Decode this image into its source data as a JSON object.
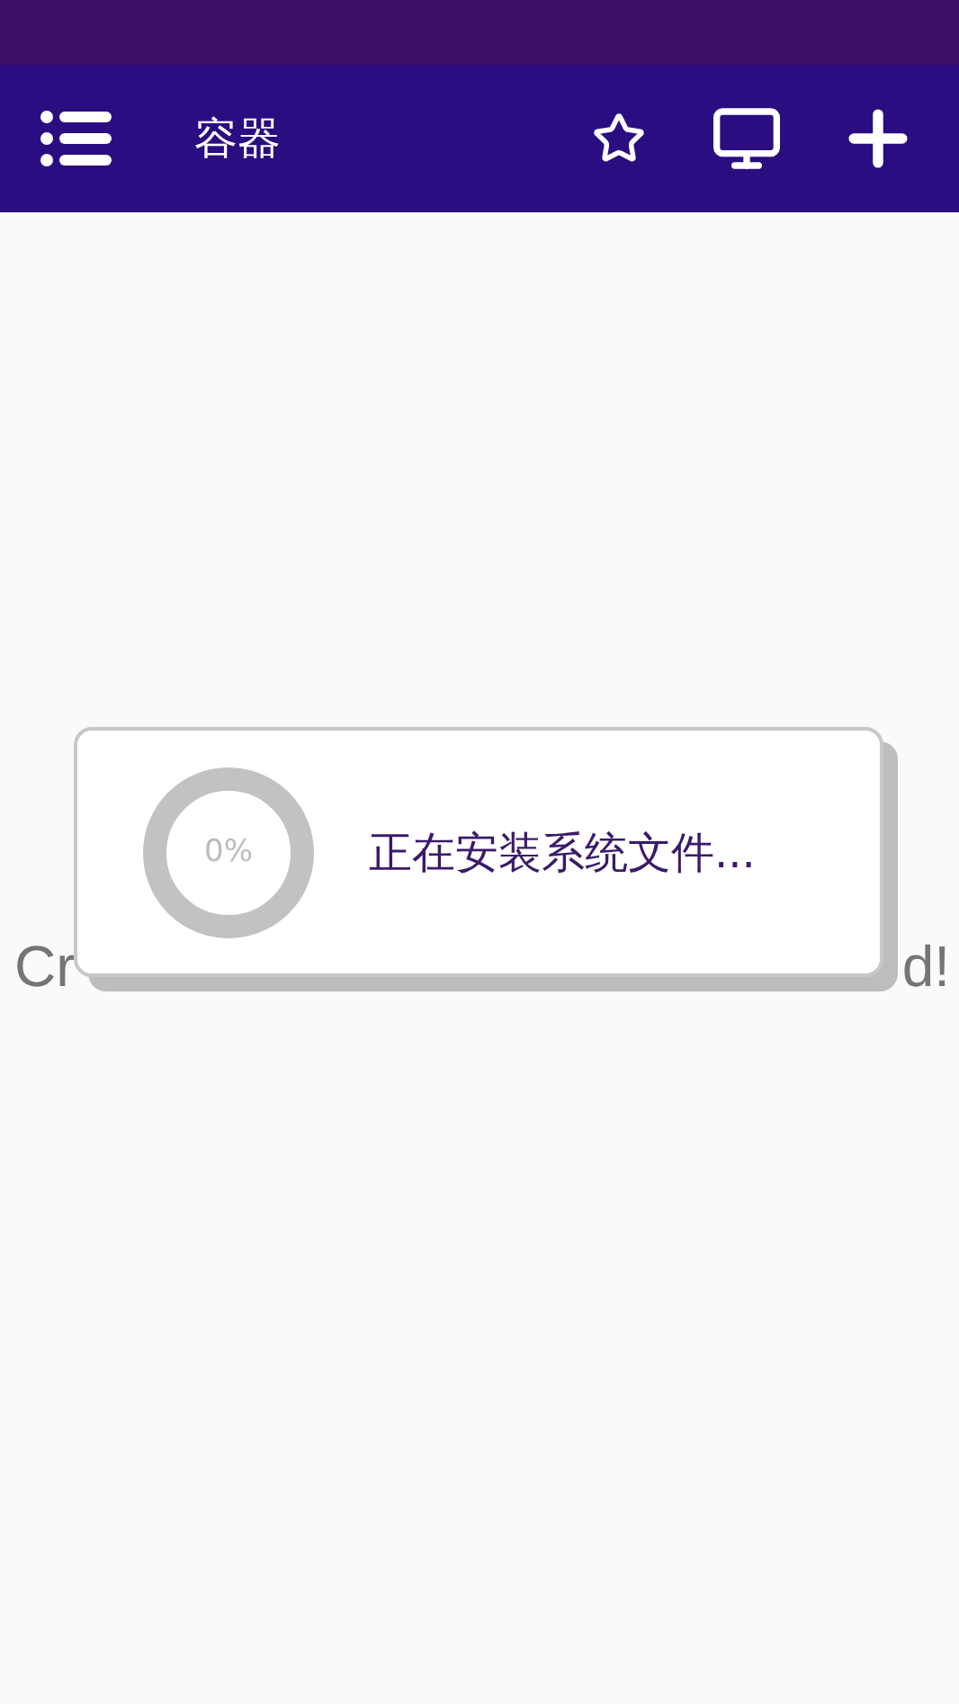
{
  "app_bar": {
    "title": "容器"
  },
  "background_text": {
    "start": "Cr",
    "end": "d!"
  },
  "dialog": {
    "progress": {
      "level": 0,
      "reading": "0%"
    },
    "message": "正在安装系统文件..."
  }
}
